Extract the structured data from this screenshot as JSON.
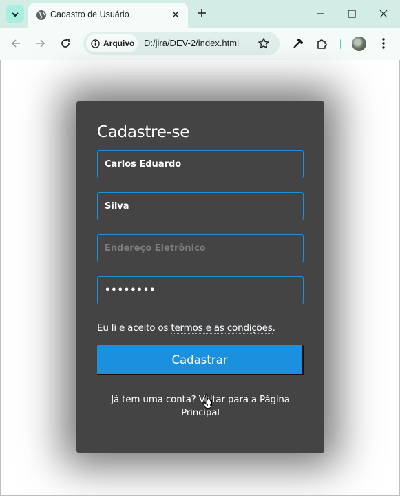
{
  "browser": {
    "tab_title": "Cadastro de Usuário",
    "security_chip": "Arquivo",
    "url": "D:/jira/DEV-2/index.html"
  },
  "form": {
    "title": "Cadastre-se",
    "first_name_value": "Carlos Eduardo",
    "last_name_value": "Silva",
    "email_placeholder": "Endereço Eletrônico",
    "email_value": "",
    "password_value": "12345678",
    "terms_prefix": "Eu li e aceito os",
    "terms_link": "termos e as condições",
    "terms_suffix": ".",
    "submit_label": "Cadastrar",
    "login_text": "Já tem uma conta?",
    "login_link": "Voltar para a Página Principal"
  },
  "colors": {
    "card_background": "#444444",
    "accent": "#1a90de",
    "input_border": "#1e8fdc",
    "chrome_background": "#d3ece6"
  },
  "icons": [
    "tab-search-icon",
    "globe-icon",
    "close-icon",
    "plus-icon",
    "minimize-icon",
    "maximize-icon",
    "back-icon",
    "forward-icon",
    "reload-icon",
    "info-icon",
    "star-icon",
    "eyedropper-icon",
    "extensions-icon",
    "avatar",
    "more-menu-icon",
    "hand-cursor-icon"
  ]
}
